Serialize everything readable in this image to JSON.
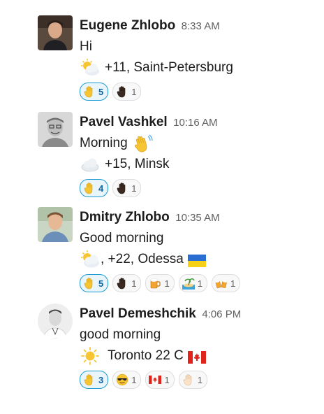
{
  "messages": [
    {
      "sender": "Eugene Zhlobo",
      "time": "8:33 AM",
      "greeting": "Hi",
      "weather_text": "+11, Saint-Petersburg",
      "weather_icon": "sun-behind-cloud-icon",
      "reactions": [
        {
          "icon": "raised-hand-icon",
          "count": "5",
          "active": true
        },
        {
          "icon": "raised-hand-dark-icon",
          "count": "1",
          "active": false
        }
      ]
    },
    {
      "sender": "Pavel Vashkel",
      "time": "10:16 AM",
      "greeting": "Morning",
      "greeting_icon": "waving-hand-icon",
      "weather_text": "+15, Minsk",
      "weather_icon": "cloud-icon",
      "reactions": [
        {
          "icon": "raised-hand-icon",
          "count": "4",
          "active": true
        },
        {
          "icon": "raised-hand-dark-icon",
          "count": "1",
          "active": false
        }
      ]
    },
    {
      "sender": "Dmitry Zhlobo",
      "time": "10:35 AM",
      "greeting": "Good morning",
      "weather_text": ", +22, Odessa",
      "weather_icon": "sun-behind-cloud-icon",
      "flag": "ukraine-flag-icon",
      "reactions": [
        {
          "icon": "raised-hand-icon",
          "count": "5",
          "active": true
        },
        {
          "icon": "raised-hand-dark-icon",
          "count": "1",
          "active": false
        },
        {
          "icon": "beer-mug-icon",
          "count": "1",
          "active": false
        },
        {
          "icon": "beach-island-icon",
          "count": "1",
          "active": false
        },
        {
          "icon": "clinking-beer-icon",
          "count": "1",
          "active": false
        }
      ]
    },
    {
      "sender": "Pavel Demeshchik",
      "time": "4:06 PM",
      "greeting": "good morning",
      "weather_text": "Toronto 22 C",
      "weather_icon": "sun-icon",
      "flag": "canada-flag-icon",
      "reactions": [
        {
          "icon": "raised-hand-icon",
          "count": "3",
          "active": true
        },
        {
          "icon": "sunglasses-face-icon",
          "count": "1",
          "active": false
        },
        {
          "icon": "canada-flag-icon",
          "count": "1",
          "active": false
        },
        {
          "icon": "raised-hand-light-icon",
          "count": "1",
          "active": false
        }
      ]
    }
  ],
  "colors": {
    "active_border": "#1d9bd1",
    "active_bg": "#e8f5fa",
    "active_text": "#1264a3",
    "time_text": "#616061"
  }
}
